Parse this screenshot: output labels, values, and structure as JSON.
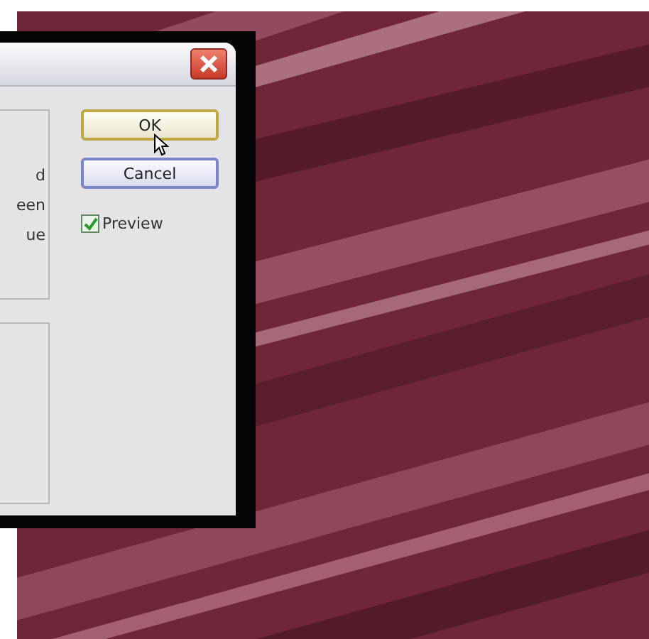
{
  "dialog": {
    "panel_text": [
      "d",
      "een",
      "ue"
    ],
    "buttons": [
      {
        "label": "OK",
        "default": true
      },
      {
        "label": "Cancel",
        "default": false
      }
    ],
    "preview": {
      "label": "Preview",
      "checked": true
    }
  }
}
